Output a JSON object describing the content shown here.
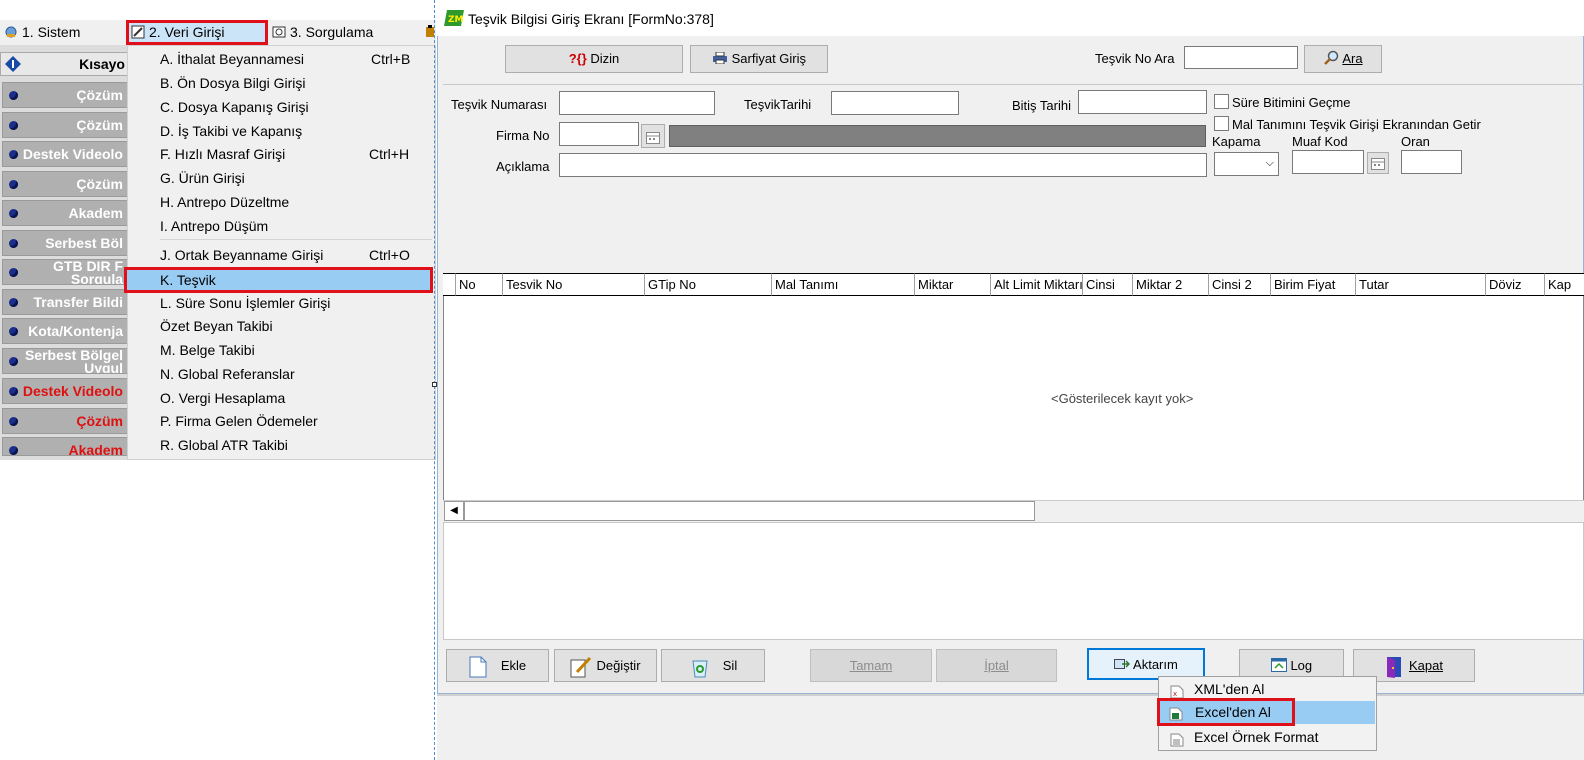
{
  "menubar": {
    "items": [
      {
        "label": "1.   Sistem"
      },
      {
        "label": "2.   Veri Girişi"
      },
      {
        "label": "3.   Sorgulama"
      }
    ]
  },
  "sidebar": {
    "header": "Kısayo",
    "items": [
      {
        "label": "Çözüm"
      },
      {
        "label": "Çözüm"
      },
      {
        "label": "Destek Videolo"
      },
      {
        "label": "Çözüm"
      },
      {
        "label": "Akadem"
      },
      {
        "label": "Serbest Böl"
      },
      {
        "label": "GTB DIR F",
        "label2": "Sorgula"
      },
      {
        "label": "Transfer Bildi"
      },
      {
        "label": "Kota/Kontenja"
      },
      {
        "label": "Serbest Bölgel",
        "label2": "Uygul"
      },
      {
        "label": "Destek Videolo"
      },
      {
        "label": "Çözüm"
      },
      {
        "label": "Akadem"
      }
    ]
  },
  "dropdown": {
    "items": [
      {
        "label": "A.   İthalat Beyannamesi",
        "shortcut": "Ctrl+B"
      },
      {
        "label": "B.   Ön Dosya Bilgi Girişi",
        "shortcut": ""
      },
      {
        "label": "C.   Dosya Kapanış Girişi",
        "shortcut": ""
      },
      {
        "label": "D.   İş Takibi ve Kapanış",
        "shortcut": ""
      },
      {
        "label": "F.   Hızlı Masraf Girişi",
        "shortcut": "Ctrl+H"
      },
      {
        "label": "G.   Ürün Girişi",
        "shortcut": ""
      },
      {
        "label": "H.   Antrepo Düzeltme",
        "shortcut": ""
      },
      {
        "label": "I.    Antrepo Düşüm",
        "shortcut": ""
      },
      {
        "label": "J.   Ortak Beyanname Girişi",
        "shortcut": "Ctrl+O"
      },
      {
        "label": "K.   Teşvik",
        "shortcut": ""
      },
      {
        "label": "L.   Süre Sonu İşlemler Girişi",
        "shortcut": ""
      },
      {
        "label": "      Özet Beyan Takibi",
        "shortcut": ""
      },
      {
        "label": "M.   Belge Takibi",
        "shortcut": ""
      },
      {
        "label": "N.  Global Referanslar",
        "shortcut": ""
      },
      {
        "label": "O. Vergi Hesaplama",
        "shortcut": ""
      },
      {
        "label": "P. Firma Gelen Ödemeler",
        "shortcut": ""
      },
      {
        "label": "R. Global ATR Takibi",
        "shortcut": ""
      }
    ]
  },
  "window": {
    "title": "Teşvik Bilgisi Giriş Ekranı [FormNo:378]",
    "toolbar": {
      "dizin_label": "Dizin",
      "sarfiyat_label": "Sarfiyat Giriş",
      "search_label": "Teşvik No Ara",
      "search_value": "",
      "ara_label": "Ara"
    },
    "form": {
      "tesvik_numarasi_label": "Teşvik Numarası",
      "tesvik_tarihi_label": "TeşvikTarihi",
      "bitis_tarihi_label": "Bitiş Tarihi",
      "sure_label": "Süre Bitimini Geçme",
      "mal_tanimi_label": "Mal Tanımını Teşvik Girişi Ekranından Getir",
      "firma_no_label": "Firma No",
      "kapama_label": "Kapama",
      "muaf_kod_label": "Muaf Kod",
      "oran_label": "Oran",
      "aciklama_label": "Açıklama"
    },
    "grid": {
      "columns": [
        "No",
        "Tesvik No",
        "GTip No",
        "Mal Tanımı",
        "Miktar",
        "Alt Limit Miktarı",
        "Cinsi",
        "Miktar 2",
        "Cinsi 2",
        "Birim Fiyat",
        "Tutar",
        "Döviz",
        "Kap"
      ],
      "empty_text": "<Gösterilecek kayıt yok>"
    },
    "buttons": {
      "ekle": "Ekle",
      "degistir": "Değiştir",
      "sil": "Sil",
      "tamam": "Tamam",
      "iptal": "İptal",
      "aktarim": "Aktarım",
      "log": "Log",
      "kapat": "Kapat"
    },
    "context_menu": {
      "items": [
        {
          "label": "XML'den Al"
        },
        {
          "label": "Excel'den Al"
        },
        {
          "label": "Excel Örnek Format"
        }
      ]
    }
  },
  "colors": {
    "highlight_red": "#e0101a",
    "selection_blue": "#99ccf3",
    "sidebar_gray": "#b0b0b0"
  }
}
